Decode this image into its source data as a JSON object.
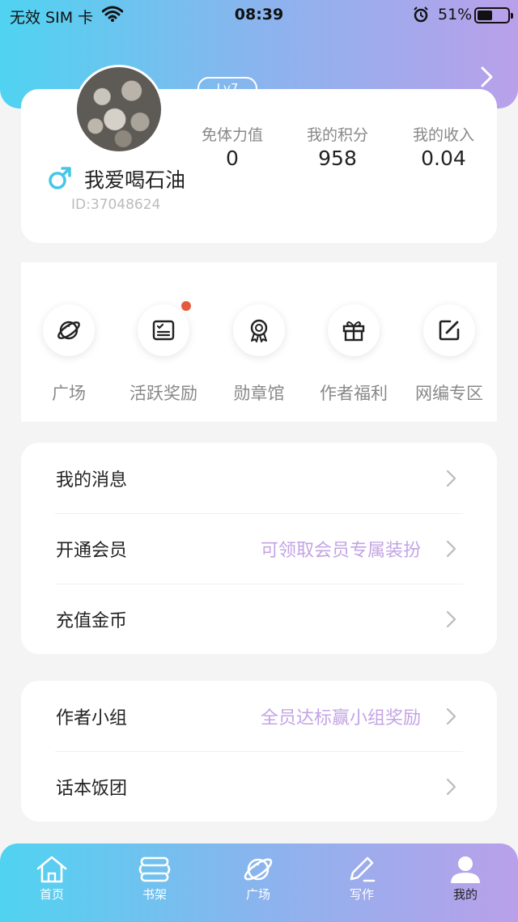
{
  "status_bar": {
    "carrier": "无效 SIM 卡",
    "time": "08:39",
    "battery_percent": "51%",
    "battery_level": 0.51
  },
  "profile": {
    "level": "Lv7",
    "username": "我爱喝石油",
    "user_id": "ID:37048624",
    "stats": [
      {
        "label": "免体力值",
        "value": "0"
      },
      {
        "label": "我的积分",
        "value": "958"
      },
      {
        "label": "我的收入",
        "value": "0.04"
      }
    ]
  },
  "quick_links": [
    {
      "label": "广场",
      "icon": "planet-icon",
      "badge": false
    },
    {
      "label": "活跃奖励",
      "icon": "checklist-icon",
      "badge": true
    },
    {
      "label": "勋章馆",
      "icon": "medal-icon",
      "badge": false
    },
    {
      "label": "作者福利",
      "icon": "gift-icon",
      "badge": false
    },
    {
      "label": "网编专区",
      "icon": "edit-icon",
      "badge": false
    }
  ],
  "menu_group_1": [
    {
      "label": "我的消息",
      "hint": ""
    },
    {
      "label": "开通会员",
      "hint": "可领取会员专属装扮"
    },
    {
      "label": "充值金币",
      "hint": ""
    }
  ],
  "menu_group_2": [
    {
      "label": "作者小组",
      "hint": "全员达标赢小组奖励"
    },
    {
      "label": "话本饭团",
      "hint": ""
    }
  ],
  "tab_bar": [
    {
      "label": "首页",
      "icon": "home-icon",
      "active": false
    },
    {
      "label": "书架",
      "icon": "bookshelf-icon",
      "active": false
    },
    {
      "label": "广场",
      "icon": "planet-icon",
      "active": false
    },
    {
      "label": "写作",
      "icon": "write-icon",
      "active": false
    },
    {
      "label": "我的",
      "icon": "user-icon",
      "active": true
    }
  ],
  "colors": {
    "gradient_start": "#4fd3f0",
    "gradient_end": "#b9a0ea",
    "hint_text": "#c3a4e4",
    "badge_dot": "#e55a3c",
    "gender_icon": "#43c6e8"
  }
}
